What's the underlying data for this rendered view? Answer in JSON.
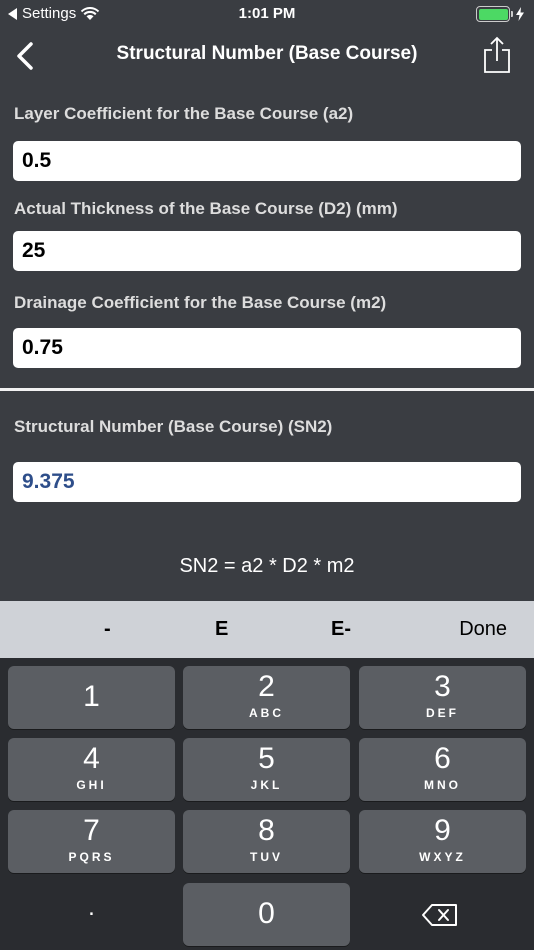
{
  "status": {
    "carrier": "Settings",
    "time": "1:01 PM"
  },
  "nav": {
    "title": "Structural Number (Base Course)"
  },
  "fields": [
    {
      "label": "Layer Coefficient for the Base Course (a2)",
      "value": "0.5"
    },
    {
      "label": "Actual Thickness of the Base Course (D2) (mm)",
      "value": "25"
    },
    {
      "label": "Drainage Coefficient for the Base Course (m2)",
      "value": "0.75"
    }
  ],
  "result": {
    "label": "Structural Number (Base Course) (SN2)",
    "value": "9.375"
  },
  "formula": "SN2 = a2 * D2 * m2",
  "accessory": {
    "minus": "-",
    "e": "E",
    "e_minus": "E-",
    "done": "Done"
  },
  "keypad": {
    "keys": [
      {
        "num": "1",
        "letters": ""
      },
      {
        "num": "2",
        "letters": "ABC"
      },
      {
        "num": "3",
        "letters": "DEF"
      },
      {
        "num": "4",
        "letters": "GHI"
      },
      {
        "num": "5",
        "letters": "JKL"
      },
      {
        "num": "6",
        "letters": "MNO"
      },
      {
        "num": "7",
        "letters": "PQRS"
      },
      {
        "num": "8",
        "letters": "TUV"
      },
      {
        "num": "9",
        "letters": "WXYZ"
      },
      {
        "num": "0",
        "letters": ""
      }
    ],
    "dot": "."
  },
  "colors": {
    "background": "#3a3d42",
    "result_text": "#2e4e8a",
    "battery": "#4cd964"
  }
}
